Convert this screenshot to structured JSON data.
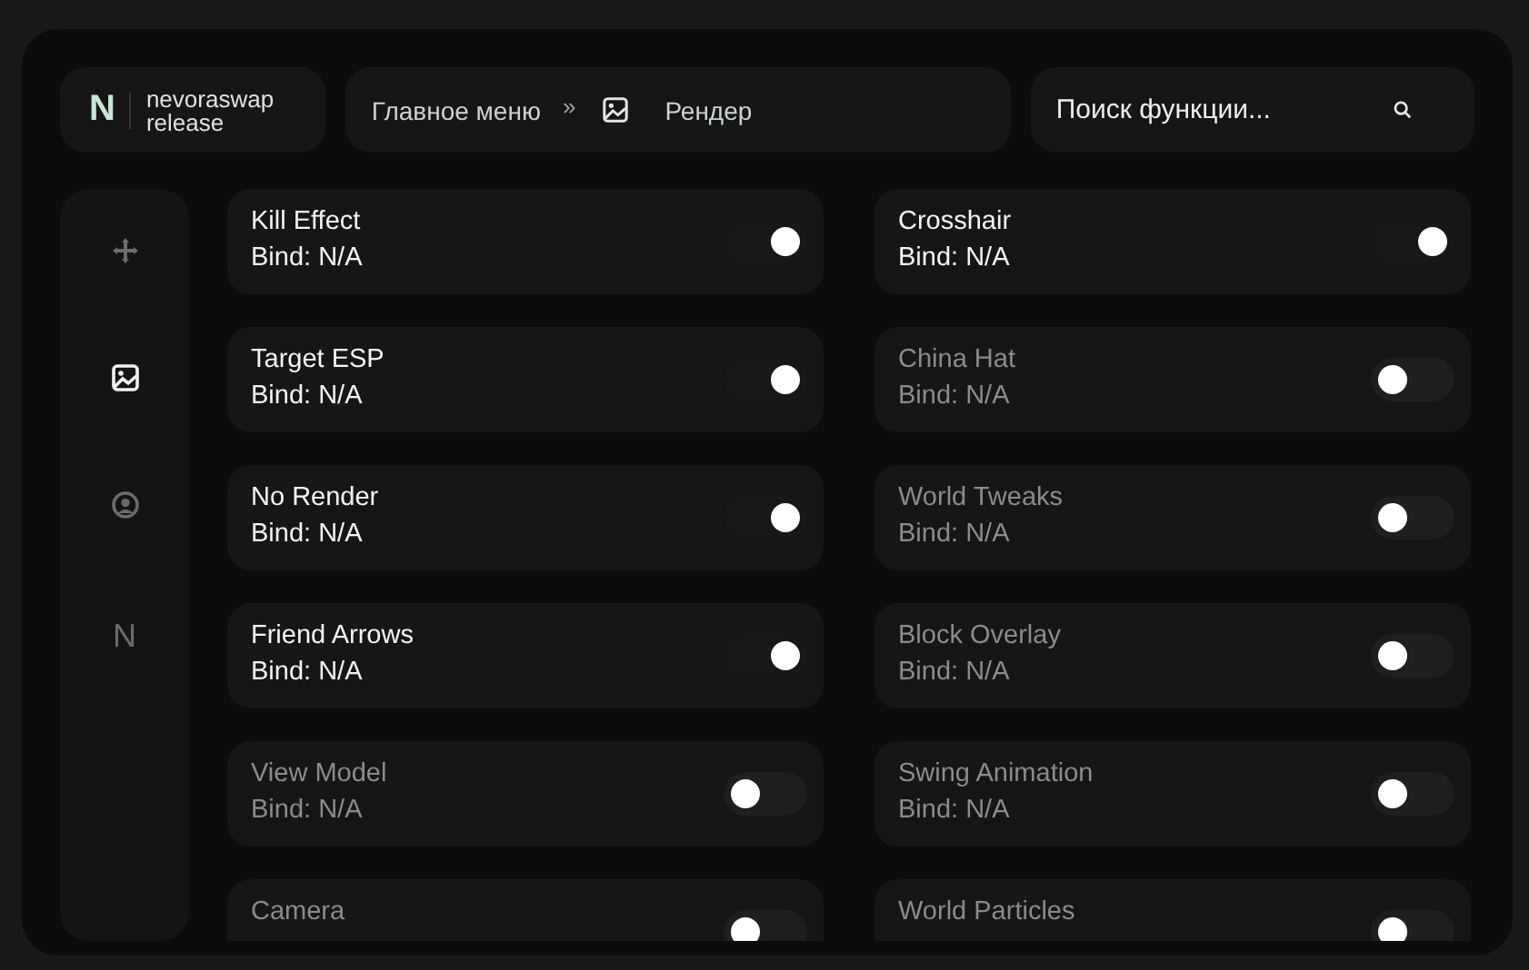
{
  "brand": {
    "letter": "N",
    "name": "nevoraswap release"
  },
  "breadcrumb": {
    "root": "Главное меню",
    "separator": "»",
    "current": "Рендер"
  },
  "search": {
    "placeholder": "Поиск функции..."
  },
  "sidebar": {
    "items": [
      {
        "kind": "move",
        "selected": false
      },
      {
        "kind": "image",
        "selected": true
      },
      {
        "kind": "user",
        "selected": false
      },
      {
        "kind": "letter",
        "label": "N",
        "selected": false
      }
    ]
  },
  "modules": [
    {
      "name": "Kill Effect",
      "bind": "Bind: N/A",
      "enabled": true
    },
    {
      "name": "Crosshair",
      "bind": "Bind: N/A",
      "enabled": true
    },
    {
      "name": "Target ESP",
      "bind": "Bind: N/A",
      "enabled": true
    },
    {
      "name": "China Hat",
      "bind": "Bind: N/A",
      "enabled": false
    },
    {
      "name": "No Render",
      "bind": "Bind: N/A",
      "enabled": true
    },
    {
      "name": "World Tweaks",
      "bind": "Bind: N/A",
      "enabled": false
    },
    {
      "name": "Friend Arrows",
      "bind": "Bind: N/A",
      "enabled": true
    },
    {
      "name": "Block Overlay",
      "bind": "Bind: N/A",
      "enabled": false
    },
    {
      "name": "View Model",
      "bind": "Bind: N/A",
      "enabled": false
    },
    {
      "name": "Swing Animation",
      "bind": "Bind: N/A",
      "enabled": false
    },
    {
      "name": "Camera",
      "enabled": false
    },
    {
      "name": "World Particles",
      "enabled": false
    }
  ]
}
